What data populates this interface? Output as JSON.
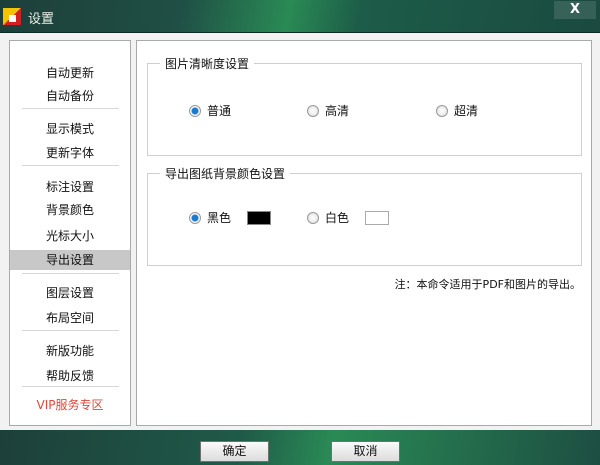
{
  "window": {
    "title": "设置",
    "close": "X"
  },
  "sidebar": {
    "items": [
      {
        "label": "自动更新"
      },
      {
        "label": "自动备份"
      },
      {
        "label": "显示模式"
      },
      {
        "label": "更新字体"
      },
      {
        "label": "标注设置"
      },
      {
        "label": "背景颜色"
      },
      {
        "label": "光标大小"
      },
      {
        "label": "导出设置",
        "selected": true
      },
      {
        "label": "图层设置"
      },
      {
        "label": "布局空间"
      },
      {
        "label": "新版功能"
      },
      {
        "label": "帮助反馈"
      },
      {
        "label": "VIP服务专区"
      }
    ]
  },
  "clarity": {
    "title": "图片清晰度设置",
    "options": [
      {
        "label": "普通",
        "checked": true
      },
      {
        "label": "高清"
      },
      {
        "label": "超清"
      }
    ]
  },
  "background": {
    "title": "导出图纸背景颜色设置",
    "options": [
      {
        "label": "黑色",
        "checked": true,
        "color": "#000000"
      },
      {
        "label": "白色",
        "color": "#ffffff"
      }
    ]
  },
  "note": "注：本命令适用于PDF和图片的导出。",
  "buttons": {
    "ok": "确定",
    "cancel": "取消"
  }
}
